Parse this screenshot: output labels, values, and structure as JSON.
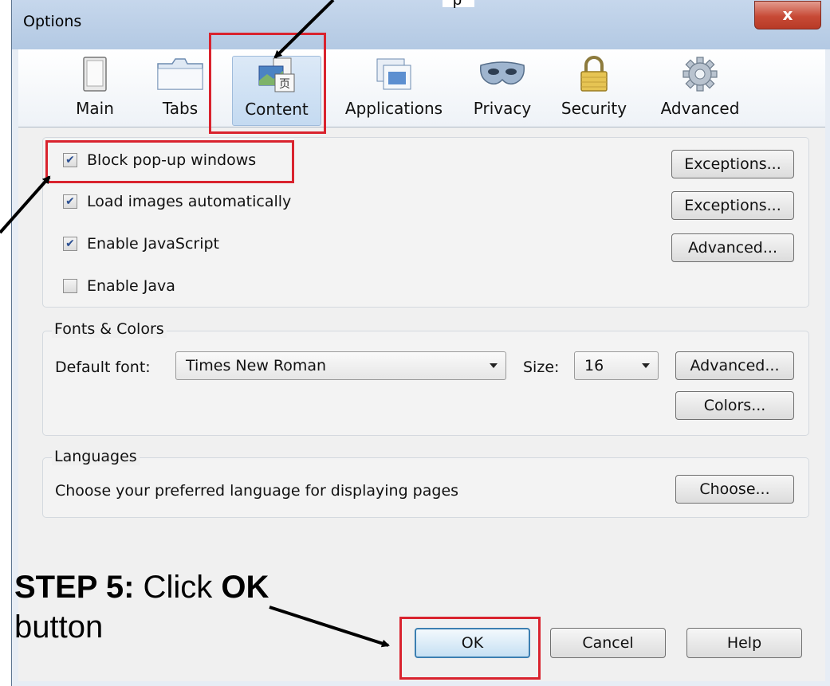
{
  "window": {
    "title": "Options",
    "close_symbol": "x"
  },
  "toolbar": {
    "tabs": [
      {
        "label": "Main",
        "icon": "main-icon"
      },
      {
        "label": "Tabs",
        "icon": "tabs-icon"
      },
      {
        "label": "Content",
        "icon": "content-icon"
      },
      {
        "label": "Applications",
        "icon": "applications-icon"
      },
      {
        "label": "Privacy",
        "icon": "privacy-mask-icon"
      },
      {
        "label": "Security",
        "icon": "lock-icon"
      },
      {
        "label": "Advanced",
        "icon": "gear-icon"
      }
    ],
    "selected": "Content"
  },
  "content": {
    "checkboxes": [
      {
        "label": "Block pop-up windows",
        "checked": true,
        "button": "Exceptions..."
      },
      {
        "label": "Load images automatically",
        "checked": true,
        "button": "Exceptions..."
      },
      {
        "label": "Enable JavaScript",
        "checked": true,
        "button": "Advanced..."
      },
      {
        "label": "Enable Java",
        "checked": false
      }
    ],
    "fonts": {
      "legend": "Fonts & Colors",
      "default_font_label": "Default font:",
      "default_font_value": "Times New Roman",
      "size_label": "Size:",
      "size_value": "16",
      "advanced_button": "Advanced...",
      "colors_button": "Colors..."
    },
    "languages": {
      "legend": "Languages",
      "text": "Choose your preferred language for displaying pages",
      "choose_button": "Choose..."
    }
  },
  "footer": {
    "ok": "OK",
    "cancel": "Cancel",
    "help": "Help"
  },
  "annotation": {
    "step_bold": "STEP 5:",
    "text_mid": " Click ",
    "text_bold2": "OK",
    "text_end": "button"
  },
  "colors": {
    "highlight": "#d9232e",
    "check": "#2a4e91",
    "default_button_border": "#3c7fb1"
  }
}
